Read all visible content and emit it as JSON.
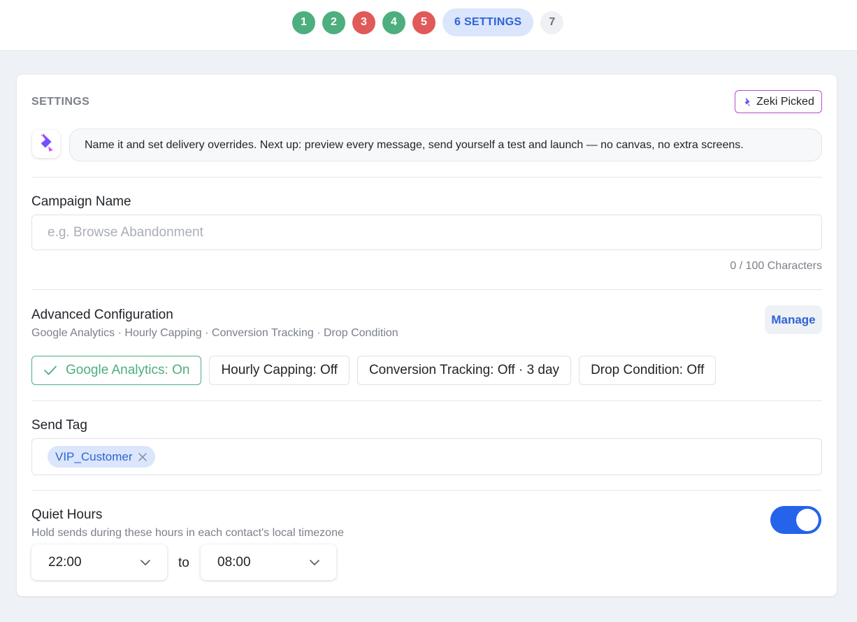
{
  "stepper": {
    "steps": [
      {
        "label": "1",
        "state": "done"
      },
      {
        "label": "2",
        "state": "done"
      },
      {
        "label": "3",
        "state": "error"
      },
      {
        "label": "4",
        "state": "done"
      },
      {
        "label": "5",
        "state": "error"
      },
      {
        "label": "6 SETTINGS",
        "state": "current"
      },
      {
        "label": "7",
        "state": "todo"
      }
    ]
  },
  "settings": {
    "title": "SETTINGS",
    "badge_label": "Zeki Picked",
    "assistant_message": "Name it and set delivery overrides. Next up: preview every message, send yourself a test and launch — no canvas, no extra screens."
  },
  "campaign_name": {
    "label": "Campaign Name",
    "value": "",
    "placeholder": "e.g. Browse Abandonment",
    "char_count": "0 / 100 Characters"
  },
  "advanced": {
    "label": "Advanced Configuration",
    "summary": "Google Analytics · Hourly Capping · Conversion Tracking · Drop Condition",
    "manage_label": "Manage",
    "chips": [
      {
        "label": "Google Analytics: On",
        "active": true
      },
      {
        "label": "Hourly Capping: Off",
        "active": false
      },
      {
        "label": "Conversion Tracking: Off · 3 day",
        "active": false
      },
      {
        "label": "Drop Condition: Off",
        "active": false
      }
    ]
  },
  "send_tag": {
    "label": "Send Tag",
    "tags": [
      "VIP_Customer"
    ]
  },
  "quiet_hours": {
    "label": "Quiet Hours",
    "description": "Hold sends during these hours in each contact's local timezone",
    "enabled": true,
    "start": "22:00",
    "separator": "to",
    "end": "08:00"
  },
  "colors": {
    "done": "#4caf7d",
    "error": "#e05a59",
    "current_bg": "#dbe5fb",
    "accent": "#2563eb",
    "zeki_border": "#b44bd9"
  },
  "icons": {
    "zeki": "zeki-logo-icon",
    "check": "check-icon",
    "remove": "close-icon",
    "dropdown": "chevron-down-icon"
  }
}
